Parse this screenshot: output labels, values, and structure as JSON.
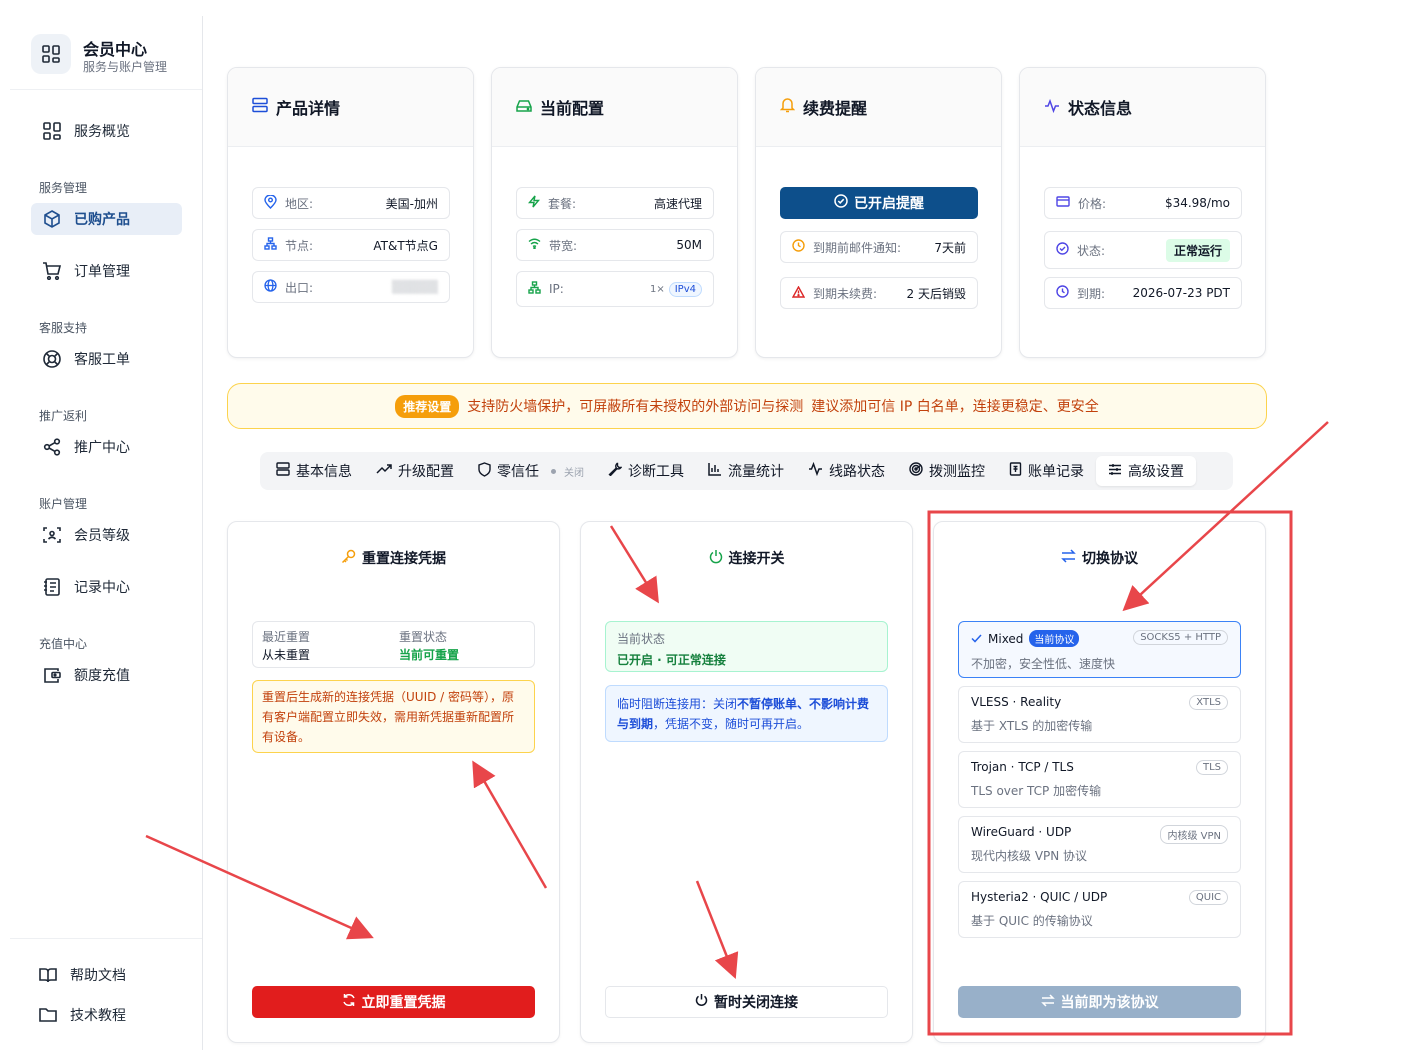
{
  "brand": {
    "title": "会员中心",
    "subtitle": "服务与账户管理"
  },
  "sidebar": {
    "overview": "服务概览",
    "groups": {
      "service": "服务管理",
      "support": "客服支持",
      "promo": "推广返利",
      "account": "账户管理",
      "recharge": "充值中心"
    },
    "items": {
      "purchased": "已购产品",
      "orders": "订单管理",
      "tickets": "客服工单",
      "promo_center": "推广中心",
      "member_level": "会员等级",
      "records": "记录中心",
      "topup": "额度充值"
    },
    "footer": {
      "help": "帮助文档",
      "tutorial": "技术教程"
    }
  },
  "cards": {
    "product": {
      "title": "产品详情",
      "region_k": "地区:",
      "region_v": "美国-加州",
      "node_k": "节点:",
      "node_v": "AT&T节点G",
      "exit_k": "出口:",
      "exit_v": "▒▒▒▒▒"
    },
    "config": {
      "title": "当前配置",
      "plan_k": "套餐:",
      "plan_v": "高速代理",
      "bw_k": "带宽:",
      "bw_v": "50M",
      "ip_k": "IP:",
      "ip_count": "1×",
      "ip_type": "IPv4"
    },
    "renew": {
      "title": "续费提醒",
      "enabled_btn": "已开启提醒",
      "mail_k": "到期前邮件通知:",
      "mail_v": "7天前",
      "destroy_k": "到期未续费:",
      "destroy_v": "2 天后销毁"
    },
    "status": {
      "title": "状态信息",
      "price_k": "价格:",
      "price_v": "$34.98/mo",
      "state_k": "状态:",
      "state_v": "正常运行",
      "expire_k": "到期:",
      "expire_v": "2026-07-23 PDT"
    }
  },
  "notice": {
    "tag": "推荐设置",
    "text1": "支持防火墙保护，可屏蔽所有未授权的外部访问与探测",
    "text2": "建议添加可信 IP 白名单，连接更稳定、更安全"
  },
  "tabs": [
    "基本信息",
    "升级配置",
    "零信任",
    "诊断工具",
    "流量统计",
    "线路状态",
    "拨测监控",
    "账单记录",
    "高级设置"
  ],
  "tab_off": "关闭",
  "reset": {
    "title": "重置连接凭据",
    "last_k": "最近重置",
    "last_v": "从未重置",
    "state_k": "重置状态",
    "state_v": "当前可重置",
    "warn": "重置后生成新的连接凭据（UUID / 密码等），原有客户端配置立即失效，需用新凭据重新配置所有设备。",
    "button": "立即重置凭据"
  },
  "conn": {
    "title": "连接开关",
    "state_k": "当前状态",
    "state_v": "已开启 · 可正常连接",
    "info_a": "临时阻断连接用：关闭",
    "info_b": "不暂停账单、不影响计费与到期",
    "info_c": "，凭据不变，随时可再开启。",
    "button": "暂时关闭连接"
  },
  "proto": {
    "title": "切换协议",
    "current_badge": "当前协议",
    "items": [
      {
        "name": "Mixed",
        "tag": "SOCKS5 + HTTP",
        "desc": "不加密，安全性低、速度快"
      },
      {
        "name": "VLESS · Reality",
        "tag": "XTLS",
        "desc": "基于 XTLS 的加密传输"
      },
      {
        "name": "Trojan · TCP / TLS",
        "tag": "TLS",
        "desc": "TLS over TCP 加密传输"
      },
      {
        "name": "WireGuard · UDP",
        "tag": "内核级 VPN",
        "desc": "现代内核级 VPN 协议"
      },
      {
        "name": "Hysteria2 · QUIC / UDP",
        "tag": "QUIC",
        "desc": "基于 QUIC 的传输协议"
      }
    ],
    "button": "当前即为该协议"
  },
  "colors": {
    "accent": "#0d4f8b",
    "danger": "#e11d1d",
    "annotation": "#e8464a"
  }
}
